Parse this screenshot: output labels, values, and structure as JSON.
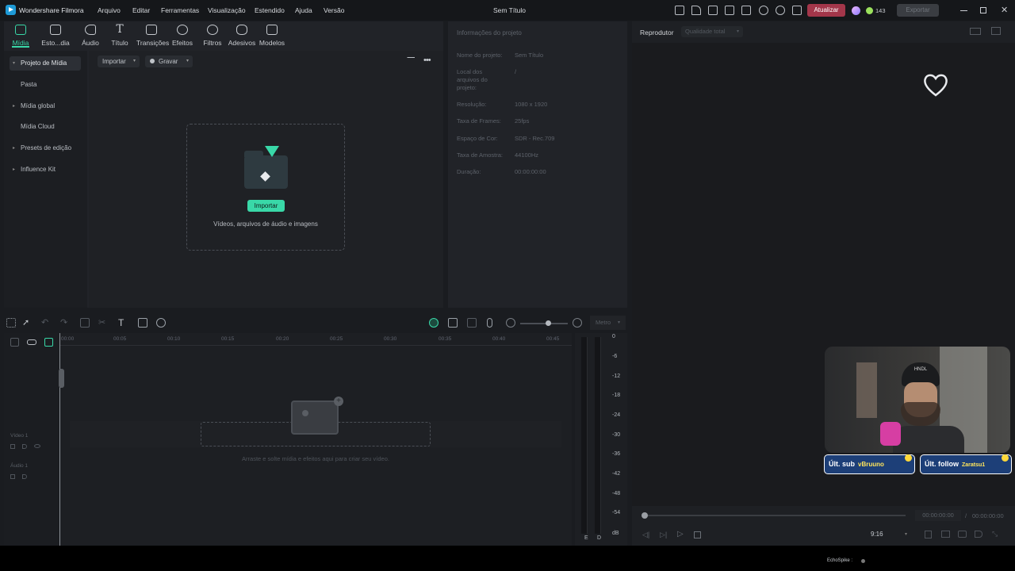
{
  "app": {
    "name": "Wondershare Filmora",
    "window_title": "Sem Título",
    "menu": [
      "Arquivo",
      "Editar",
      "Ferramentas",
      "Visualização",
      "Estendido",
      "Ajuda",
      "Versão"
    ],
    "update_label": "Atualizar",
    "credits": "143",
    "export_label": "Exportar"
  },
  "toolbar": {
    "tools": [
      {
        "label": "Mídia",
        "icon": "media-icon"
      },
      {
        "label": "Esto...dia",
        "icon": "stock-media-icon"
      },
      {
        "label": "Áudio",
        "icon": "music-note-icon"
      },
      {
        "label": "Título",
        "icon": "title-text-icon"
      },
      {
        "label": "Transições",
        "icon": "transitions-icon"
      },
      {
        "label": "Efeitos",
        "icon": "effects-icon"
      },
      {
        "label": "Filtros",
        "icon": "filters-icon"
      },
      {
        "label": "Adesivos",
        "icon": "stickers-icon"
      },
      {
        "label": "Modelos",
        "icon": "templates-icon"
      }
    ]
  },
  "sidebar": {
    "items": [
      {
        "label": "Projeto de Mídia",
        "arrow": "▾"
      },
      {
        "label": "Pasta",
        "arrow": ""
      },
      {
        "label": "Mídia global",
        "arrow": "▸"
      },
      {
        "label": "Mídia Cloud",
        "arrow": ""
      },
      {
        "label": "Presets de edição",
        "arrow": "▸"
      },
      {
        "label": "Influence Kit",
        "arrow": "▸"
      }
    ]
  },
  "media": {
    "import_dropdown": "Importar",
    "record_dropdown": "Gravar",
    "import_button": "Importar",
    "drop_hint": "Vídeos, arquivos de áudio e imagens"
  },
  "project_info": {
    "title": "Informações do projeto",
    "rows": [
      {
        "label": "Nome do projeto:",
        "value": "Sem Título"
      },
      {
        "label": "Local dos arquivos do projeto:",
        "value": "/"
      },
      {
        "label": "Resolução:",
        "value": "1080 x 1920"
      },
      {
        "label": "Taxa de Frames:",
        "value": "25fps"
      },
      {
        "label": "Espaço de Cor:",
        "value": "SDR - Rec.709"
      },
      {
        "label": "Taxa de Amostra:",
        "value": "44100Hz"
      },
      {
        "label": "Duração:",
        "value": "00:00:00:00"
      }
    ]
  },
  "player": {
    "title": "Reprodutor",
    "quality": "Qualidade total",
    "current_time": "00:00:00:00",
    "separator": "/",
    "total_time": "00:00:00:00",
    "aspect_ratio": "9:16"
  },
  "timeline": {
    "meter_label": "Metro",
    "ticks": [
      "00:00",
      "00:05",
      "00:10",
      "00:15",
      "00:20",
      "00:25",
      "00:30",
      "00:35",
      "00:40",
      "00:45"
    ],
    "video_track": "Vídeo 1",
    "audio_track": "Áudio 1",
    "drop_hint": "Arraste e solte mídia e efeitos aqui para criar seu vídeo."
  },
  "audio_meter": {
    "levels": [
      "0",
      "-6",
      "-12",
      "-18",
      "-24",
      "-30",
      "-36",
      "-42",
      "-48",
      "-54",
      "dB"
    ],
    "channels": [
      "E",
      "D"
    ]
  },
  "overlay": {
    "last_sub_label": "Últ. sub",
    "last_sub_user": "vBruuno",
    "last_follow_label": "Últ. follow",
    "last_follow_user": "Zaratsu1",
    "cap_text": "HNDL",
    "footer_text": "EchoSpike :"
  },
  "colors": {
    "accent": "#39d8a8",
    "update_button": "#a3364a",
    "card_blue": "#1d3f78"
  }
}
